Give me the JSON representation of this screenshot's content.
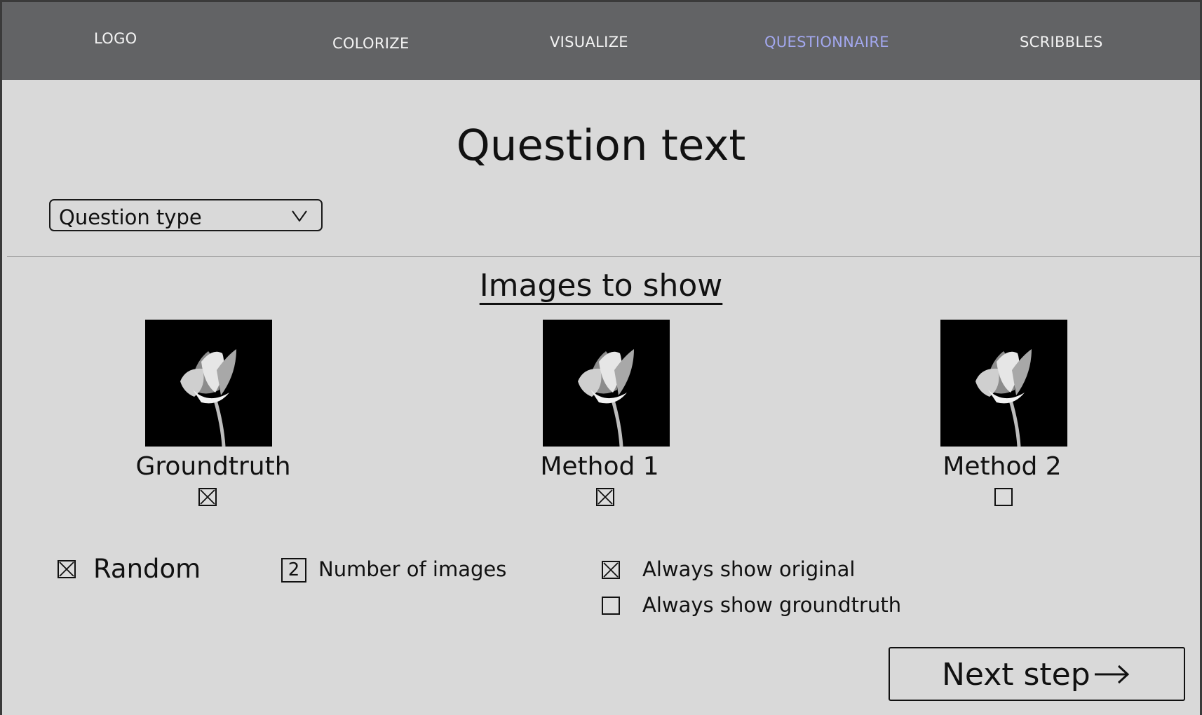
{
  "nav": {
    "logo": "LOGO",
    "items": [
      "COLORIZE",
      "VISUALIZE",
      "QUESTIONNAIRE",
      "SCRIBBLES"
    ],
    "active": "QUESTIONNAIRE",
    "active_color": "#a3a8ef"
  },
  "question": {
    "title": "Question text",
    "type_select": {
      "value": "Question type",
      "icon": "chevron-down-icon"
    }
  },
  "images": {
    "heading": "Images to show",
    "items": [
      {
        "label": "Groundtruth",
        "checked": true,
        "image": "lotus-flower-grayscale"
      },
      {
        "label": "Method 1",
        "checked": true,
        "image": "lotus-flower-grayscale"
      },
      {
        "label": "Method 2",
        "checked": false,
        "image": "lotus-flower-grayscale"
      }
    ]
  },
  "options": {
    "random": {
      "label": "Random",
      "checked": true
    },
    "number_of_images": {
      "value": "2",
      "label": "Number of images"
    },
    "always_show_original": {
      "label": "Always show original",
      "checked": true
    },
    "always_show_groundtruth": {
      "label": "Always show groundtruth",
      "checked": false
    }
  },
  "next_button": {
    "label": "Next step",
    "icon": "arrow-right-icon"
  }
}
